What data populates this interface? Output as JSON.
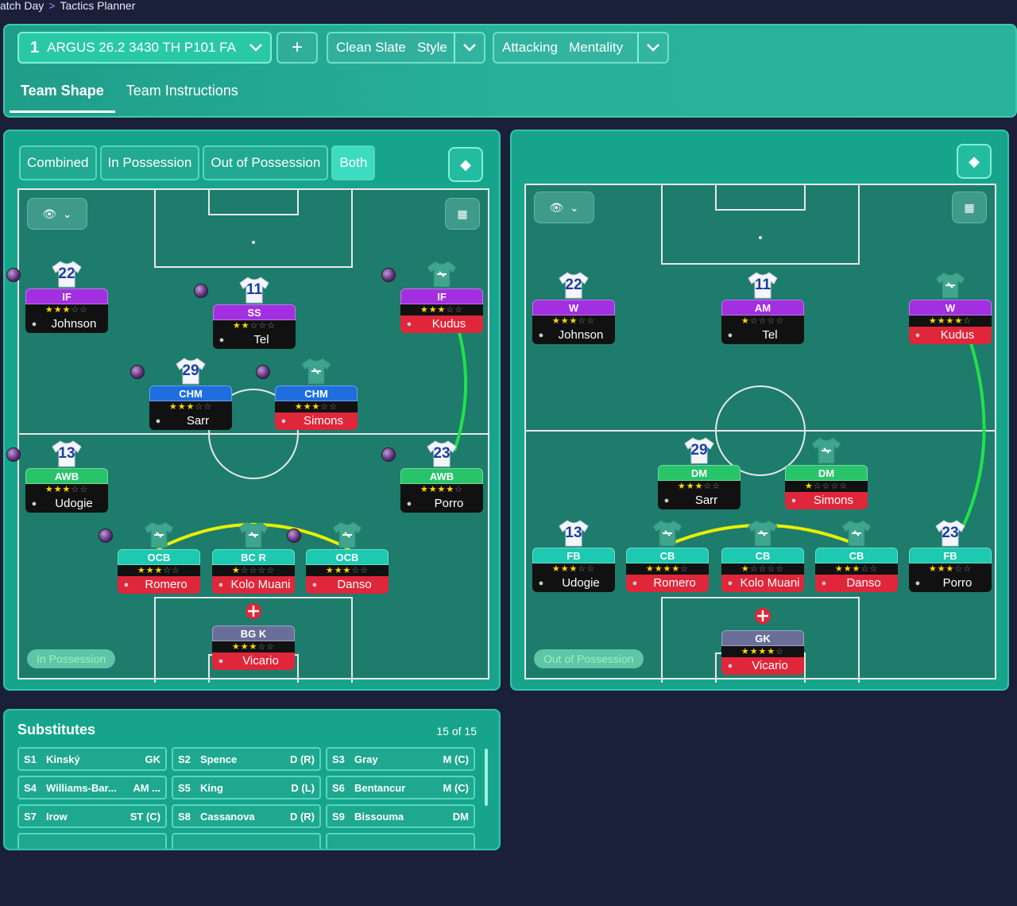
{
  "breadcrumb": {
    "parent": "atch Day",
    "sep": ">",
    "current": "Tactics Planner"
  },
  "tactic": {
    "number": "1",
    "name": "ARGUS 26.2 3430 TH P101 FA",
    "add": "+"
  },
  "style": {
    "value": "Clean Slate",
    "label": "Style"
  },
  "mentality": {
    "value": "Attacking",
    "label": "Mentality"
  },
  "tabs": [
    "Team Shape",
    "Team Instructions"
  ],
  "segments": [
    "Combined",
    "In Possession",
    "Out of Possession",
    "Both"
  ],
  "left_badge": "In Possession",
  "right_badge": "Out of Possession",
  "left_players": [
    {
      "num": "22",
      "pos": "IF",
      "stars": "★★★☆☆",
      "name": "Johnson",
      "color": "#a22fe0",
      "red": false,
      "orb": true,
      "kit": "white"
    },
    {
      "num": "11",
      "pos": "SS",
      "stars": "★★☆☆☆",
      "name": "Tel",
      "color": "#a22fe0",
      "red": false,
      "orb": true,
      "kit": "white"
    },
    {
      "num": "",
      "pos": "IF",
      "stars": "★★★☆☆",
      "name": "Kudus",
      "color": "#a22fe0",
      "red": true,
      "orb": true,
      "kit": "green"
    },
    {
      "num": "29",
      "pos": "CHM",
      "stars": "★★★☆☆",
      "name": "Sarr",
      "color": "#1e6ee0",
      "red": false,
      "orb": true,
      "kit": "white"
    },
    {
      "num": "",
      "pos": "CHM",
      "stars": "★★★☆☆",
      "name": "Simons",
      "color": "#1e6ee0",
      "red": true,
      "orb": true,
      "kit": "green"
    },
    {
      "num": "13",
      "pos": "AWB",
      "stars": "★★★☆☆",
      "name": "Udogie",
      "color": "#28c46a",
      "red": false,
      "orb": true,
      "kit": "white"
    },
    {
      "num": "23",
      "pos": "AWB",
      "stars": "★★★★☆",
      "name": "Porro",
      "color": "#28c46a",
      "red": false,
      "orb": true,
      "kit": "white"
    },
    {
      "num": "",
      "pos": "OCB",
      "stars": "★★★☆☆",
      "name": "Romero",
      "color": "#1dc9b0",
      "red": true,
      "orb": true,
      "kit": "green"
    },
    {
      "num": "",
      "pos": "BC R",
      "stars": "★☆☆☆☆",
      "name": "Kolo Muani",
      "color": "#1dc9b0",
      "red": true,
      "orb": false,
      "kit": "green"
    },
    {
      "num": "",
      "pos": "OCB",
      "stars": "★★★☆☆",
      "name": "Danso",
      "color": "#1dc9b0",
      "red": true,
      "orb": true,
      "kit": "green"
    },
    {
      "num": "",
      "pos": "BG K",
      "stars": "★★★☆☆",
      "name": "Vicario",
      "color": "#6a6f9a",
      "red": true,
      "orb": false,
      "kit": "gk"
    }
  ],
  "right_players": [
    {
      "num": "22",
      "pos": "W",
      "stars": "★★★☆☆",
      "name": "Johnson",
      "color": "#a22fe0",
      "red": false,
      "kit": "white"
    },
    {
      "num": "11",
      "pos": "AM",
      "stars": "★☆☆☆☆",
      "name": "Tel",
      "color": "#a22fe0",
      "red": false,
      "kit": "white"
    },
    {
      "num": "",
      "pos": "W",
      "stars": "★★★★☆",
      "name": "Kudus",
      "color": "#a22fe0",
      "red": true,
      "kit": "green"
    },
    {
      "num": "29",
      "pos": "DM",
      "stars": "★★★☆☆",
      "name": "Sarr",
      "color": "#28c46a",
      "red": false,
      "kit": "white"
    },
    {
      "num": "",
      "pos": "DM",
      "stars": "★☆☆☆☆",
      "name": "Simons",
      "color": "#28c46a",
      "red": true,
      "kit": "green"
    },
    {
      "num": "13",
      "pos": "FB",
      "stars": "★★★☆☆",
      "name": "Udogie",
      "color": "#1dc9b0",
      "red": false,
      "kit": "white"
    },
    {
      "num": "",
      "pos": "CB",
      "stars": "★★★★☆",
      "name": "Romero",
      "color": "#1dc9b0",
      "red": true,
      "kit": "green"
    },
    {
      "num": "",
      "pos": "CB",
      "stars": "★☆☆☆☆",
      "name": "Kolo Muani",
      "color": "#1dc9b0",
      "red": true,
      "kit": "green"
    },
    {
      "num": "",
      "pos": "CB",
      "stars": "★★★☆☆",
      "name": "Danso",
      "color": "#1dc9b0",
      "red": true,
      "kit": "green"
    },
    {
      "num": "23",
      "pos": "FB",
      "stars": "★★★☆☆",
      "name": "Porro",
      "color": "#1dc9b0",
      "red": false,
      "kit": "white"
    },
    {
      "num": "",
      "pos": "GK",
      "stars": "★★★★☆",
      "name": "Vicario",
      "color": "#6a6f9a",
      "red": true,
      "kit": "gk"
    }
  ],
  "substitutes": {
    "title": "Substitutes",
    "count": "15 of 15",
    "items": [
      {
        "code": "S1",
        "name": "Kinský",
        "pos": "GK"
      },
      {
        "code": "S2",
        "name": "Spence",
        "pos": "D (R)"
      },
      {
        "code": "S3",
        "name": "Gray",
        "pos": "M (C)"
      },
      {
        "code": "S4",
        "name": "Williams-Bar...",
        "pos": "AM ..."
      },
      {
        "code": "S5",
        "name": "King",
        "pos": "D (L)"
      },
      {
        "code": "S6",
        "name": "Bentancur",
        "pos": "M (C)"
      },
      {
        "code": "S7",
        "name": "Irow",
        "pos": "ST (C)"
      },
      {
        "code": "S8",
        "name": "Cassanova",
        "pos": "D (R)"
      },
      {
        "code": "S9",
        "name": "Bissouma",
        "pos": "DM"
      }
    ]
  }
}
